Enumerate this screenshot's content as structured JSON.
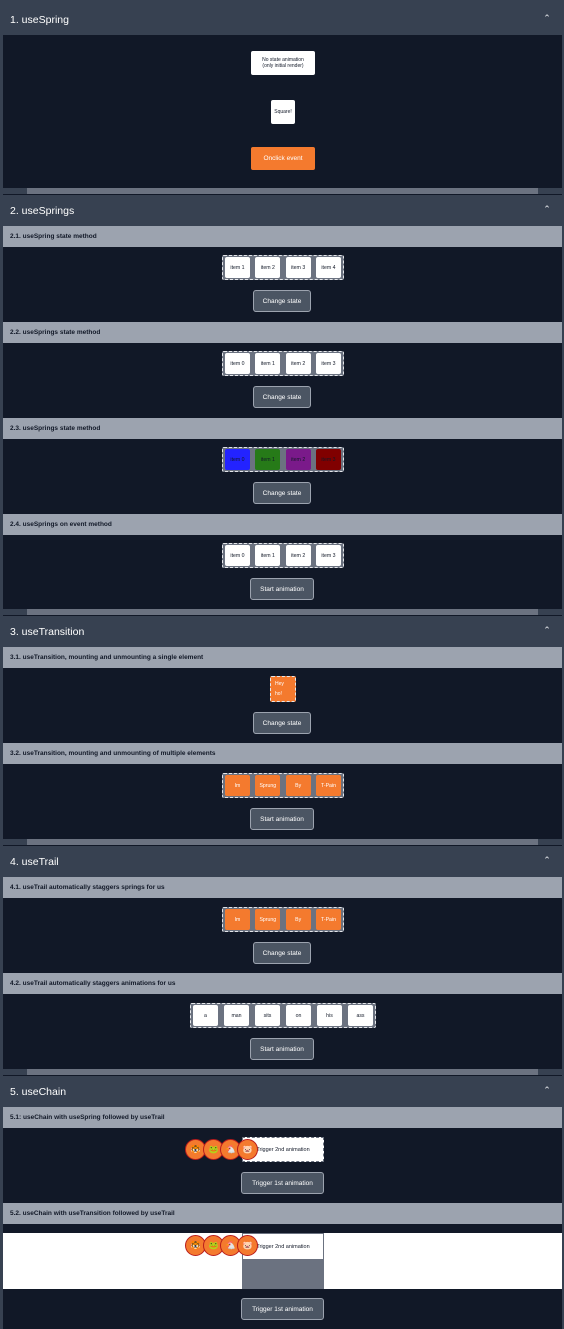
{
  "sections": {
    "s1": {
      "title": "1. useSpring",
      "static_box": [
        "No state animation",
        "(only initial render)"
      ],
      "square": "Square!",
      "button": "Onclick event"
    },
    "s2": {
      "title": "2. useSprings",
      "sub1": {
        "title": "2.1. useSpring state method",
        "items": [
          "item 1",
          "item 2",
          "item 3",
          "item 4"
        ],
        "button": "Change state"
      },
      "sub2": {
        "title": "2.2. useSprings state method",
        "items": [
          "item 0",
          "item 1",
          "item 2",
          "item 3"
        ],
        "button": "Change state"
      },
      "sub3": {
        "title": "2.3. useSprings state method",
        "items": [
          "item 0",
          "item 1",
          "item 2",
          "item 3"
        ],
        "colors": [
          "#2323ff",
          "#267a18",
          "#7a1a8a",
          "#800000"
        ],
        "button": "Change state"
      },
      "sub4": {
        "title": "2.4. useSprings on event method",
        "items": [
          "item 0",
          "item 1",
          "item 2",
          "item 3"
        ],
        "button": "Start animation"
      }
    },
    "s3": {
      "title": "3. useTransition",
      "sub1": {
        "title": "3.1. useTransition, mounting and unmounting a single element",
        "lines": [
          "Hey",
          "ho!"
        ],
        "button": "Change state"
      },
      "sub2": {
        "title": "3.2. useTransition, mounting and unmounting of multiple elements",
        "items": [
          "Im",
          "Sprung",
          "By",
          "T-Pain"
        ],
        "button": "Start animation"
      }
    },
    "s4": {
      "title": "4. useTrail",
      "sub1": {
        "title": "4.1. useTrail automatically staggers springs for us",
        "items": [
          "Im",
          "Sprung",
          "By",
          "T-Pain"
        ],
        "button": "Change state"
      },
      "sub2": {
        "title": "4.2. useTrail automatically staggers animations for us",
        "items": [
          "a",
          "man",
          "sits",
          "on",
          "his",
          "ass"
        ],
        "button": "Start animation"
      }
    },
    "s5": {
      "title": "5. useChain",
      "sub1": {
        "title": "5.1: useChain with useSpring followed by useTrail",
        "box_text": "Trigger 2nd animation",
        "emojis": [
          "🐯",
          "🐸",
          "🐔",
          "🐷"
        ],
        "button": "Trigger 1st animation"
      },
      "sub2": {
        "title": "5.2. useChain with useTransition followed by useTrail",
        "box_text": "Trigger 2nd animation",
        "emojis": [
          "🐯",
          "🐸",
          "🐔",
          "🐷"
        ],
        "button": "Trigger 1st animation"
      }
    }
  },
  "colors": {
    "accent": "#f47a2e",
    "panel": "#111827",
    "header": "#374151",
    "subheader": "#9ca3af"
  }
}
